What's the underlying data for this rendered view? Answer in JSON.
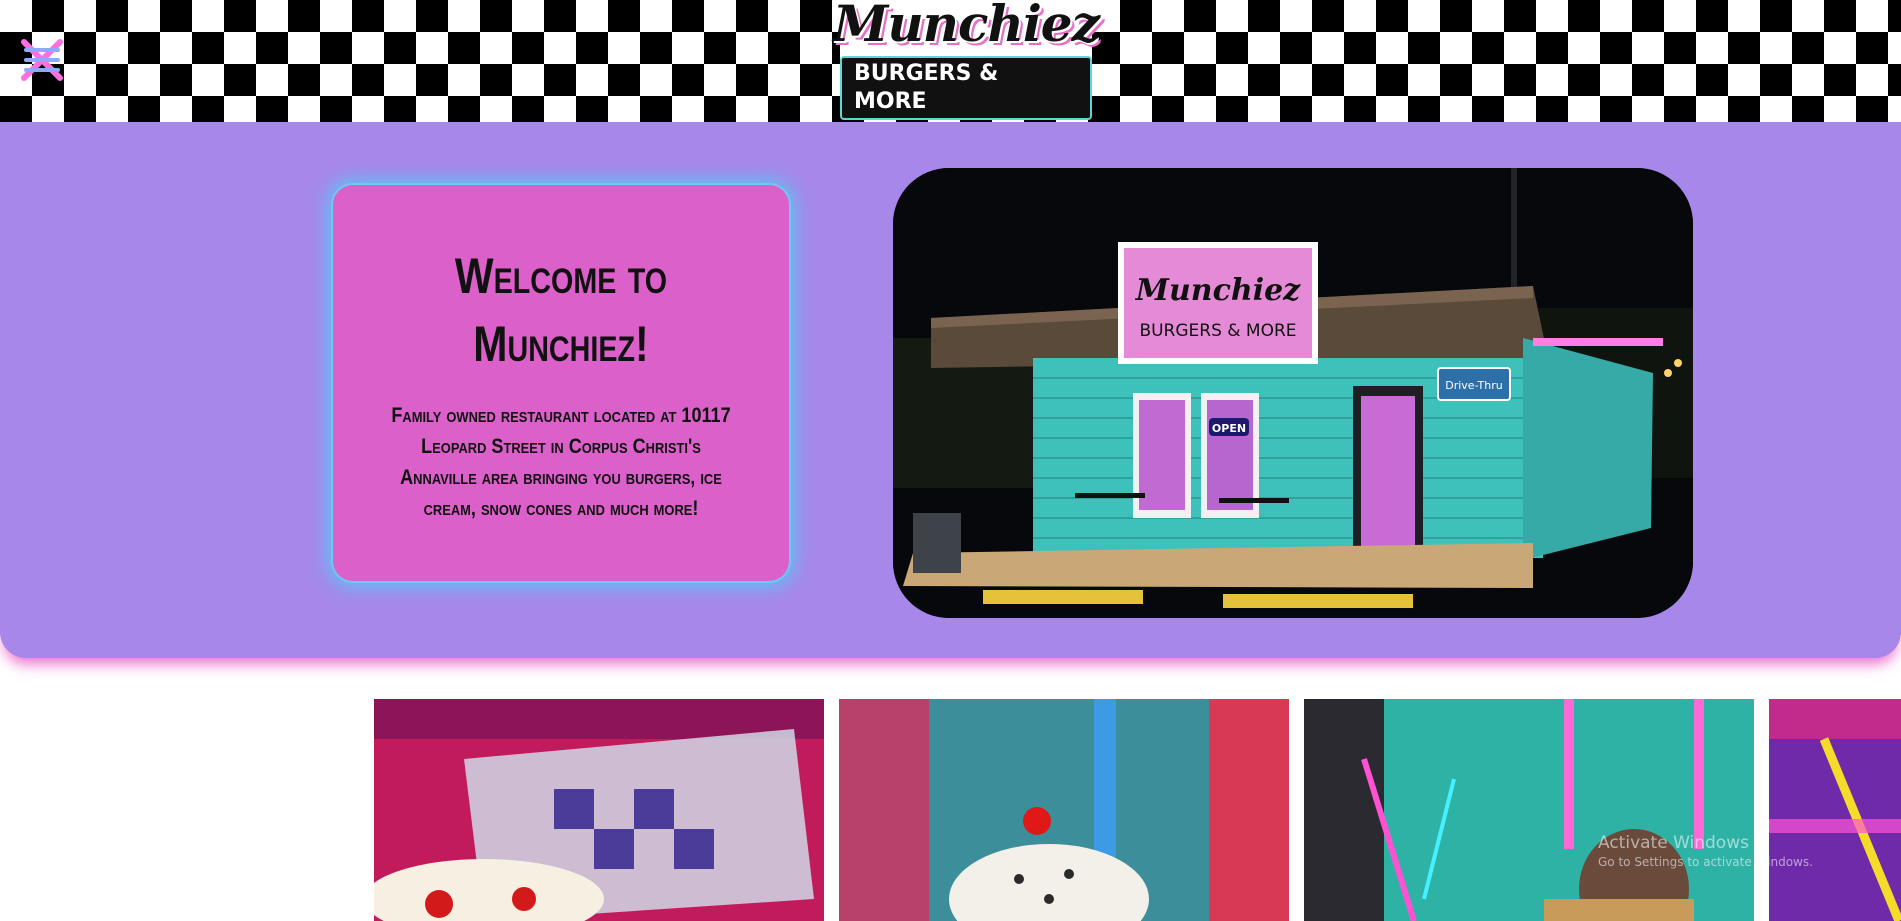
{
  "header": {
    "logo": {
      "name": "Munchiez",
      "tagline": "BURGERS & MORE"
    },
    "menu_icon": "hamburger-menu-icon"
  },
  "hero": {
    "title": "Welcome to Munchiez!",
    "description": "Family owned restaurant located at 10117 Leopard Street in Corpus Christi's Annaville area bringing you burgers, ice cream, snow cones and much more!",
    "image": {
      "sign_name": "Munchiez",
      "sign_tagline": "BURGERS & MORE",
      "drive_thru_sign": "Drive-Thru",
      "open_sign": "OPEN"
    }
  },
  "gallery": {
    "photos": [
      "banana-split",
      "milkshake",
      "diner-interior",
      "drink"
    ]
  },
  "system_overlay": {
    "title": "Activate Windows",
    "subtitle": "Go to Settings to activate Windows."
  },
  "colors": {
    "hero_bg": "#a787ea",
    "card_bg": "#dc60c9",
    "card_glow": "#5fc1f4",
    "hero_shadow": "#f06fd0",
    "accent_teal": "#5ed6d6"
  }
}
